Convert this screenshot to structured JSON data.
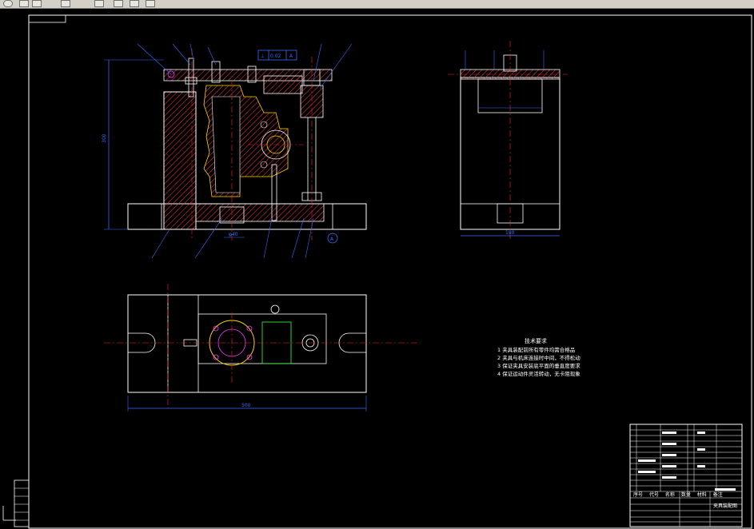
{
  "toolbar": {
    "buttons": [
      "refresh-icon",
      "file-icon",
      "back-icon",
      "save-icon",
      "copy-icon",
      "print-icon",
      "cut-icon",
      "paste-icon"
    ]
  },
  "drawing": {
    "technical_requirements": {
      "title": "技术要求",
      "items": [
        "1  夹具装配前所有零件均需合格品",
        "2  夹具与机床连接时中间，不得松动",
        "3  保证夹具安装底平面的垂直度要求",
        "4 保证运动件灵活转动，无卡阻现象"
      ]
    },
    "dimensions": {
      "height_left": "300",
      "width_bottom": "500",
      "side_width": "180",
      "side_inner": "φ40"
    },
    "tolerance_frame": [
      "⊥",
      "0.02",
      "A"
    ],
    "datum_label": "A",
    "title_block": {
      "drawing_name": "夹具装配图",
      "headers": [
        "序号",
        "代号",
        "名称",
        "数量",
        "材料",
        "备注"
      ]
    }
  },
  "colors": {
    "background": "#000000",
    "outline": "#ffffff",
    "section": "#ff3b3b",
    "dimension": "#3a6bff",
    "highlight": "#ffd400",
    "magenta": "#ff3cff",
    "green": "#3cff3c",
    "centerline": "#ff2020"
  }
}
